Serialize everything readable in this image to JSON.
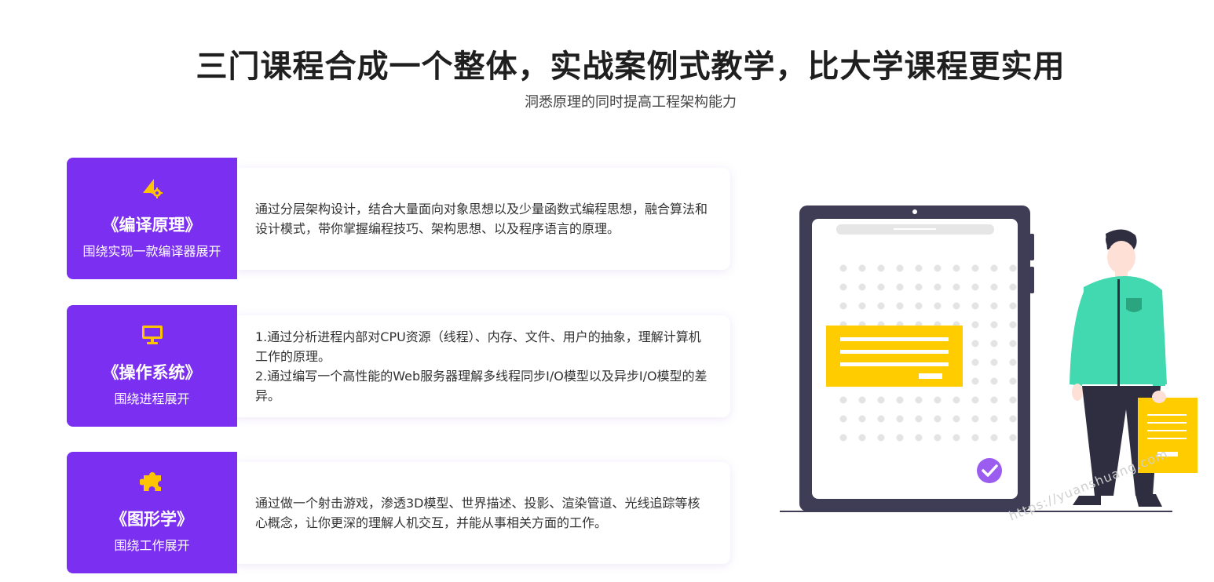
{
  "header": {
    "title": "三门课程合成一个整体，实战案例式教学，比大学课程更实用",
    "subtitle": "洞悉原理的同时提高工程架构能力"
  },
  "courses": [
    {
      "icon": "compiler-gear-icon",
      "name": "《编译原理》",
      "sub": "围绕实现一款编译器展开",
      "desc": "通过分层架构设计，结合大量面向对象思想以及少量函数式编程思想，融合算法和设计模式，带你掌握编程技巧、架构思想、以及程序语言的原理。"
    },
    {
      "icon": "monitor-icon",
      "name": "《操作系统》",
      "sub": "围绕进程展开",
      "desc": "1.通过分析进程内部对CPU资源（线程）、内存、文件、用户的抽象，理解计算机工作的原理。\n2.通过编写一个高性能的Web服务器理解多线程同步I/O模型以及异步I/O模型的差异。"
    },
    {
      "icon": "puzzle-icon",
      "name": "《图形学》",
      "sub": "围绕工作展开",
      "desc": "通过做一个射击游戏，渗透3D模型、世界描述、投影、渲染管道、光线追踪等核心概念，让你更深的理解人机交互，并能从事相关方面的工作。"
    }
  ],
  "watermark": "https://yuanshuang.com",
  "colors": {
    "accent": "#7b2ff0",
    "icon": "#ffc400",
    "tablet": "#3f3d56",
    "shirt": "#43d9b0",
    "check": "#9b5cf0"
  }
}
